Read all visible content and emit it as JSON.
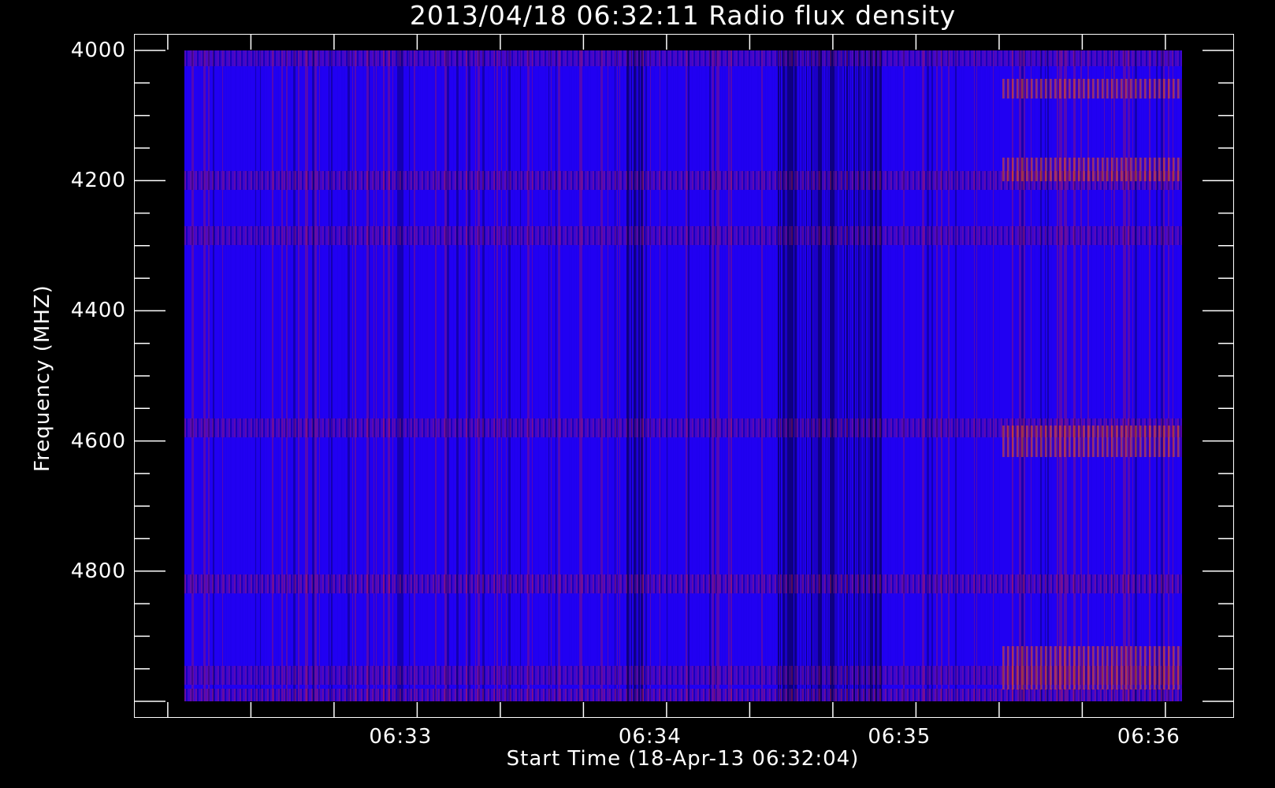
{
  "chart_data": {
    "type": "heatmap",
    "title": "2013/04/18 06:32:11 Radio flux density",
    "xlabel": "Start Time (18-Apr-13 06:32:04)",
    "ylabel": "Frequency (MHZ)",
    "x_ticks": [
      "06:33",
      "06:34",
      "06:35",
      "06:36"
    ],
    "y_ticks": [
      "4000",
      "4200",
      "4400",
      "4600",
      "4800"
    ],
    "y_tick_values": [
      4000,
      4200,
      4400,
      4600,
      4800
    ],
    "x_tick_values_seconds": [
      56,
      116,
      176,
      236
    ],
    "xlim_seconds": [
      0,
      244
    ],
    "ylim": [
      4000,
      5000
    ],
    "y_inverted": true,
    "colormap": [
      "#000000",
      "#1f00ee",
      "#8a1a8a",
      "#ff2000",
      "#ffe000"
    ],
    "emission_bands_mhz": [
      {
        "freq": 4010,
        "intensity": 0.6
      },
      {
        "freq": 4200,
        "intensity": 0.8
      },
      {
        "freq": 4285,
        "intensity": 0.7
      },
      {
        "freq": 4580,
        "intensity": 0.75
      },
      {
        "freq": 4820,
        "intensity": 0.85
      },
      {
        "freq": 4960,
        "intensity": 0.7
      },
      {
        "freq": 4995,
        "intensity": 0.9
      }
    ],
    "dark_periods_seconds": [
      [
        108,
        112
      ],
      [
        145,
        170
      ]
    ],
    "bright_period_seconds": [
      200,
      244
    ]
  }
}
